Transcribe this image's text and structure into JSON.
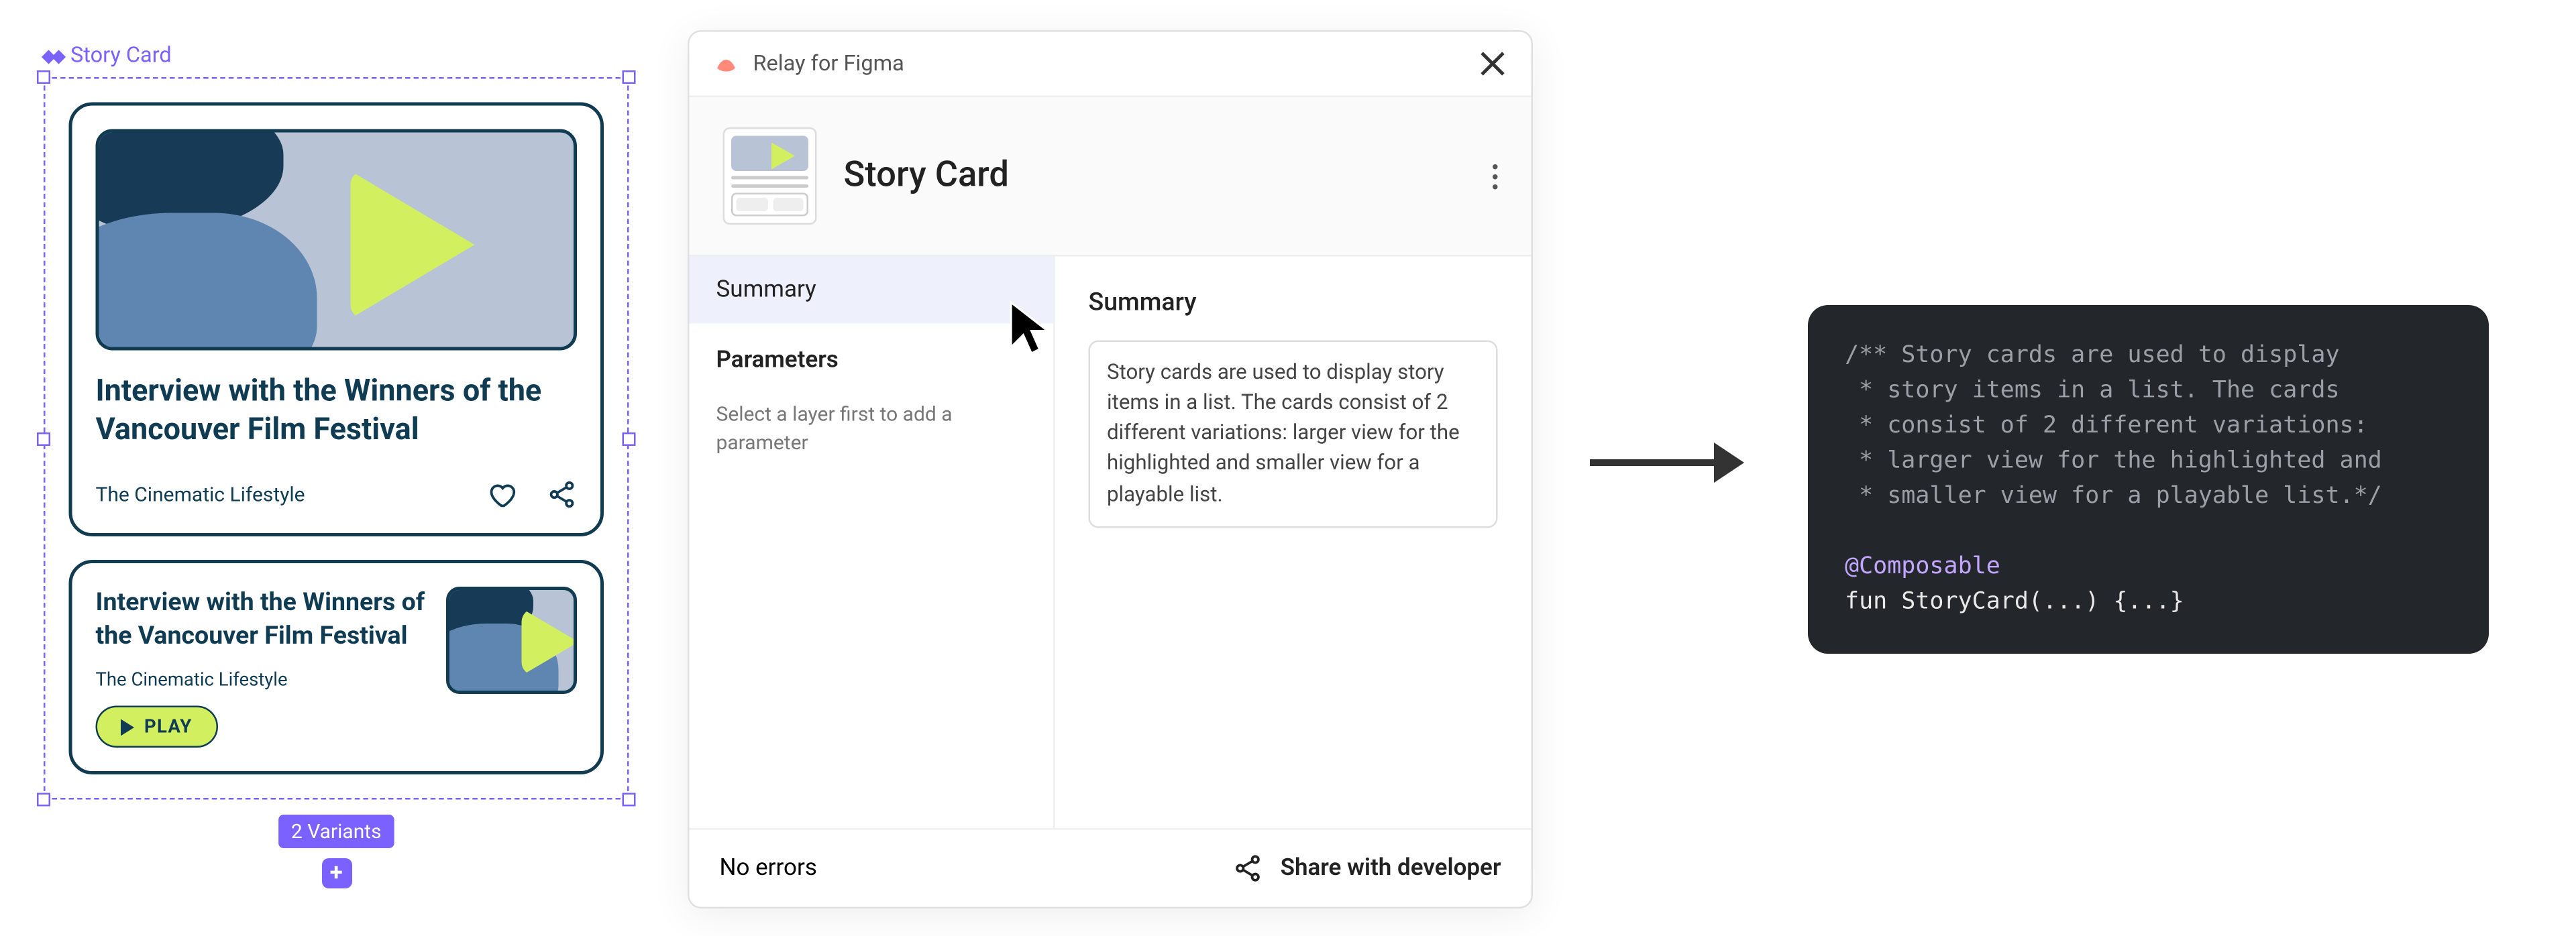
{
  "figma": {
    "component_label": "Story Card",
    "variants_badge": "2 Variants",
    "card_large": {
      "title": "Interview with the Winners of the Vancouver Film Festival",
      "subtitle": "The Cinematic Lifestyle"
    },
    "card_small": {
      "title": "Interview with the Winners of the Vancouver Film Festival",
      "subtitle": "The Cinematic Lifestyle",
      "play_label": "PLAY"
    }
  },
  "panel": {
    "brand": "Relay for Figma",
    "title": "Story Card",
    "tabs": {
      "summary": "Summary",
      "parameters": "Parameters",
      "parameters_help": "Select a layer first to add a parameter"
    },
    "main_heading": "Summary",
    "summary_text": "Story cards are used to display story items in a list. The cards consist of 2 different variations: larger view for the highlighted and smaller view for a playable list.",
    "footer": {
      "status": "No errors",
      "share": "Share with developer"
    }
  },
  "code": {
    "doc1": "/** Story cards are used to display",
    "doc2": " * story items in a list. The cards",
    "doc3": " * consist of 2 different variations:",
    "doc4": " * larger view for the highlighted and",
    "doc5": " * smaller view for a playable list.*/",
    "ann": "@Composable",
    "fn": "fun StoryCard(...) {...}"
  }
}
